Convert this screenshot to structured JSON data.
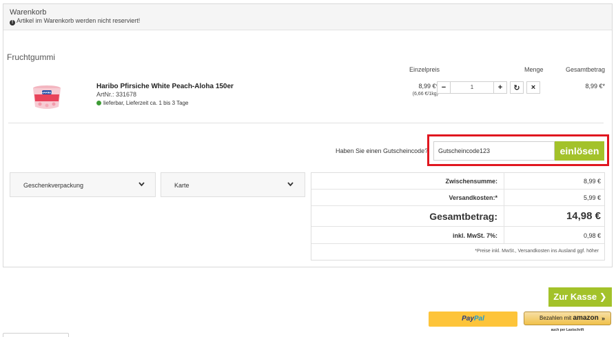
{
  "cart": {
    "title": "Warenkorb",
    "notice": "Artikel im Warenkorb werden nicht reserviert!",
    "notice_icon": "info-icon"
  },
  "category": "Fruchtgummi",
  "columns": {
    "unit_price": "Einzelpreis",
    "quantity": "Menge",
    "total": "Gesamtbetrag"
  },
  "product": {
    "name": "Haribo Pfirsiche White Peach-Aloha 150er",
    "artnr": "ArtNr.: 331678",
    "availability": "lieferbar, Lieferzeit ca. 1 bis 3 Tage",
    "availability_color": "#3d9b35",
    "image_brand": "HARIBO",
    "unit_price": "8,99 €*",
    "base_price": "(6,66 €/1kg)",
    "quantity": "1",
    "line_total": "8,99 €*",
    "qty_minus": "−",
    "qty_plus": "+",
    "qty_refresh": "↻",
    "qty_remove": "×"
  },
  "voucher": {
    "label": "Haben Sie einen Gutscheincode?",
    "value": "Gutscheincode123",
    "button": "einlösen",
    "highlight_color": "#e0161f"
  },
  "accordions": [
    {
      "label": "Geschenkverpackung",
      "icon": "chevron-down-icon"
    },
    {
      "label": "Karte",
      "icon": "chevron-down-icon"
    }
  ],
  "totals": {
    "subtotal_label": "Zwischensumme:",
    "subtotal": "8,99 €",
    "shipping_label": "Versandkosten:*",
    "shipping": "5,99 €",
    "grand_label": "Gesamtbetrag:",
    "grand": "14,98 €",
    "vat_label": "inkl. MwSt. 7%:",
    "vat": "0,98 €",
    "note": "*Preise inkl. MwSt., Versandkosten ins Ausland ggf. höher"
  },
  "checkout": {
    "label": "Zur Kasse",
    "arrow": "❯",
    "accent": "#a3c22a"
  },
  "payments": {
    "paypal_part1": "Pay",
    "paypal_part2": "Pal",
    "amazon_prefix": "Bezahlen mit",
    "amazon_brand": "amazon",
    "amazon_arrows": "»",
    "amazon_sub": "auch per Lastschrift"
  }
}
